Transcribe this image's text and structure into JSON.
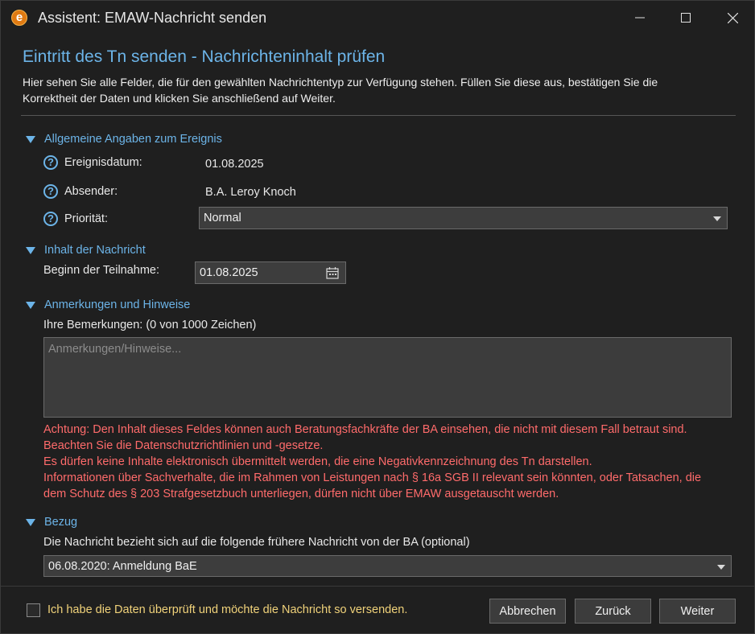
{
  "window": {
    "logo_letter": "e",
    "title": "Assistent: EMAW-Nachricht senden"
  },
  "page": {
    "heading": "Eintritt des Tn senden - Nachrichteninhalt prüfen",
    "intro_line1": "Hier sehen Sie alle Felder, die für den gewählten Nachrichtentyp zur Verfügung stehen. Füllen Sie diese aus, bestätigen Sie die",
    "intro_line2": "Korrektheit der Daten und klicken Sie anschließend auf Weiter."
  },
  "general": {
    "title": "Allgemeine Angaben zum Ereignis",
    "event_date_label": "Ereignisdatum:",
    "event_date_value": "01.08.2025",
    "sender_label": "Absender:",
    "sender_value": "B.A. Leroy Knoch",
    "priority_label": "Priorität:",
    "priority_value": "Normal"
  },
  "content": {
    "title": "Inhalt der Nachricht",
    "start_label": "Beginn der Teilnahme:",
    "start_value": "01.08.2025"
  },
  "remarks": {
    "title": "Anmerkungen und Hinweise",
    "label": "Ihre Bemerkungen: (0 von 1000 Zeichen)",
    "placeholder": "Anmerkungen/Hinweise...",
    "warning_lines": [
      "Achtung: Den Inhalt dieses Feldes können auch Beratungsfachkräfte der BA einsehen, die nicht mit diesem Fall betraut sind.",
      "Beachten Sie die Datenschutzrichtlinien und -gesetze.",
      "Es dürfen keine Inhalte elektronisch übermittelt werden, die eine Negativkennzeichnung des Tn darstellen.",
      "Informationen über Sachverhalte, die im Rahmen von Leistungen nach § 16a SGB II relevant sein könnten, oder Tatsachen, die",
      "dem Schutz des § 203 Strafgesetzbuch unterliegen, dürfen nicht über EMAW ausgetauscht werden."
    ]
  },
  "reference": {
    "title": "Bezug",
    "label": "Die Nachricht bezieht sich auf die folgende frühere Nachricht von der BA (optional)",
    "selected": "06.08.2020: Anmeldung BaE"
  },
  "footer": {
    "confirm_label": "Ich habe die Daten überprüft und möchte die Nachricht so versenden.",
    "confirm_checked": false,
    "cancel_label": "Abbrechen",
    "back_label": "Zurück",
    "next_label": "Weiter"
  }
}
